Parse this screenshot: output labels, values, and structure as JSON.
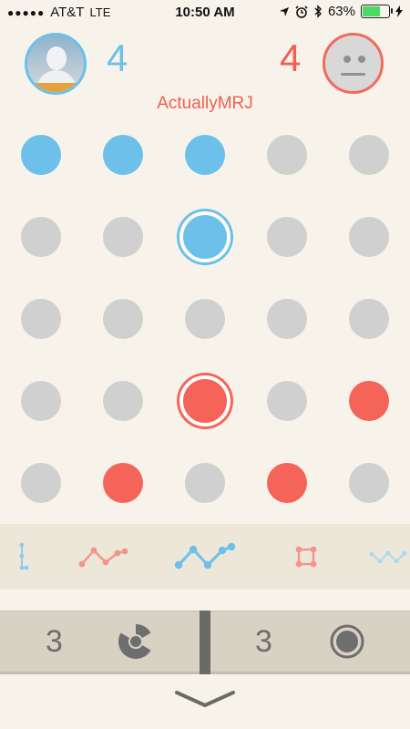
{
  "status_bar": {
    "carrier": "AT&T",
    "network": "LTE",
    "time": "10:50 AM",
    "battery": "63%"
  },
  "player": {
    "score": "4"
  },
  "opponent": {
    "score": "4",
    "name": "ActuallyMRJ"
  },
  "board": {
    "rows": [
      [
        "blue",
        "blue",
        "blue",
        "gray",
        "gray"
      ],
      [
        "gray",
        "gray",
        "blue-selected",
        "gray",
        "gray"
      ],
      [
        "gray",
        "gray",
        "gray",
        "gray",
        "gray"
      ],
      [
        "gray",
        "gray",
        "red-selected",
        "gray",
        "red"
      ],
      [
        "gray",
        "red",
        "gray",
        "red",
        "gray"
      ]
    ]
  },
  "move_history": [
    "vertical-line-icon",
    "zigzag-red-icon",
    "zigzag-blue-icon",
    "square-red-icon",
    "zigzag-blue-faded-icon"
  ],
  "powerups": [
    {
      "count": "3",
      "icon": "radiation-icon"
    },
    {
      "count": "3",
      "icon": "target-circle-icon"
    }
  ],
  "colors": {
    "blue": "#6cc0e9",
    "red": "#f56459",
    "gray": "#d0d0d0",
    "background": "#f8f3ea"
  }
}
